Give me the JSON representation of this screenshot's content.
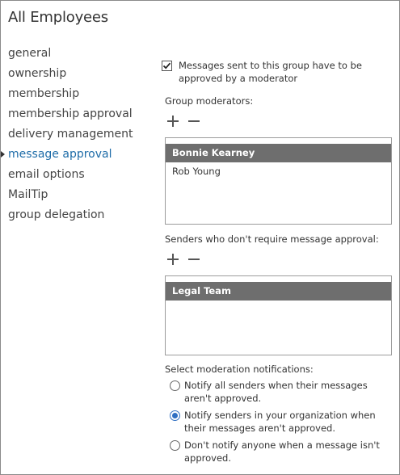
{
  "page": {
    "title": "All Employees"
  },
  "nav": {
    "items": [
      {
        "label": "general"
      },
      {
        "label": "ownership"
      },
      {
        "label": "membership"
      },
      {
        "label": "membership approval"
      },
      {
        "label": "delivery management"
      },
      {
        "label": "message approval",
        "active": true
      },
      {
        "label": "email options"
      },
      {
        "label": "MailTip"
      },
      {
        "label": "group delegation"
      }
    ]
  },
  "moderation": {
    "checkbox_label": "Messages sent to this group have to be approved by a moderator",
    "checkbox_checked": true,
    "moderators_label": "Group moderators:",
    "moderators": [
      "Bonnie Kearney",
      "Rob Young"
    ],
    "selected_moderator": "Bonnie Kearney",
    "senders_label": "Senders who don't require message approval:",
    "senders": [
      "Legal Team"
    ],
    "selected_sender": "Legal Team"
  },
  "notifications": {
    "label": "Select moderation notifications:",
    "options": [
      "Notify all senders when their messages aren't approved.",
      "Notify senders in your organization when their messages aren't approved.",
      "Don't notify anyone when a message isn't approved."
    ],
    "selected_index": 1
  },
  "colors": {
    "active_nav": "#1e6ca8",
    "selected_row": "#6e6e6e",
    "radio_accent": "#2f6fc2"
  }
}
